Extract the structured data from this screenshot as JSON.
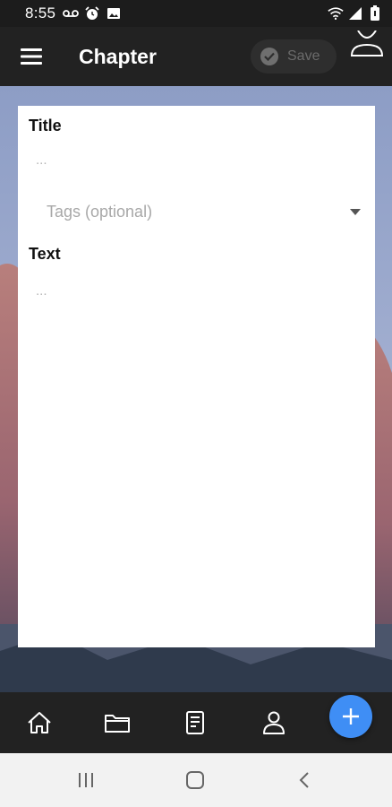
{
  "status_bar": {
    "time": "8:55",
    "left_icons": [
      "voicemail-icon",
      "alarm-icon",
      "image-icon"
    ],
    "right_icons": [
      "wifi-icon",
      "signal-icon",
      "battery-icon"
    ]
  },
  "app_bar": {
    "title": "Chapter",
    "save_label": "Save"
  },
  "form": {
    "title_label": "Title",
    "title_placeholder": "...",
    "tags_placeholder": "Tags (optional)",
    "text_label": "Text",
    "text_placeholder": "..."
  },
  "bottom_nav": {
    "items": [
      "home-icon",
      "folder-icon",
      "document-icon",
      "profile-icon"
    ],
    "fab_icon": "plus-icon"
  },
  "system_nav": {
    "buttons": [
      "recent-apps-icon",
      "home-button-icon",
      "back-icon"
    ]
  },
  "colors": {
    "fab": "#3f8ef5",
    "app_bar": "#222222",
    "card": "#ffffff"
  }
}
